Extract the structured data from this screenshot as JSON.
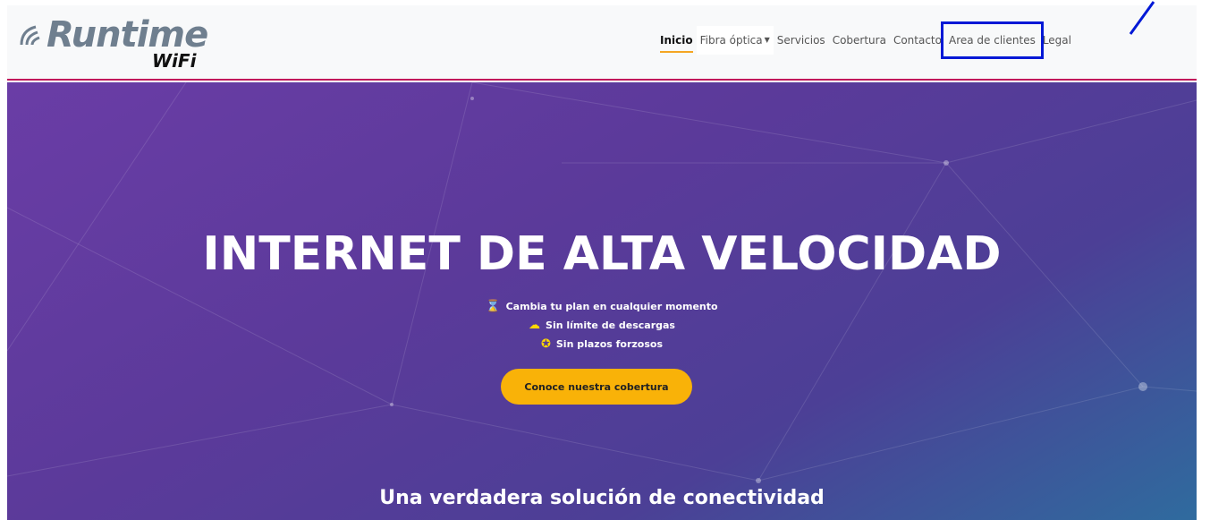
{
  "brand": {
    "name": "Runtime",
    "subname": "WiFi"
  },
  "nav": {
    "items": [
      {
        "label": "Inicio"
      },
      {
        "label": "Fibra óptica"
      },
      {
        "label": "Servicios"
      },
      {
        "label": "Cobertura"
      },
      {
        "label": "Contacto"
      },
      {
        "label": "Area de clientes"
      },
      {
        "label": "Legal"
      }
    ],
    "active_item": "Inicio",
    "highlighted_item": "Area de clientes"
  },
  "hero": {
    "title": "INTERNET DE ALTA VELOCIDAD",
    "features": [
      {
        "icon": "hourglass-icon",
        "text": "Cambia tu plan en cualquier momento"
      },
      {
        "icon": "cloud-icon",
        "text": "Sin límite de descargas"
      },
      {
        "icon": "medal-icon",
        "text": "Sin plazos forzosos"
      }
    ],
    "cta_label": "Conoce nuestra cobertura",
    "subtitle": "Una verdadera solución de conectividad"
  },
  "colors": {
    "accent": "#f9b208",
    "nav_border": "#c2185b",
    "highlight_box": "#0018d6",
    "hero_start": "#6a3da6",
    "hero_end": "#2f6b9e"
  }
}
